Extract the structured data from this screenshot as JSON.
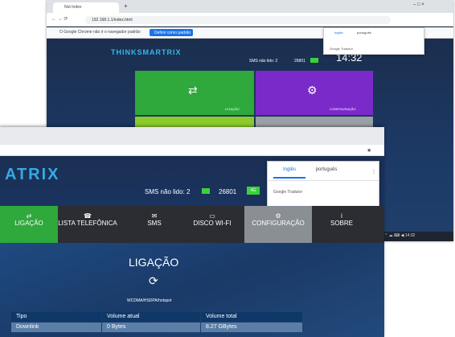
{
  "back_window": {
    "tab_label": "Not Index",
    "new_tab": "+",
    "window_controls": "–  □  ×",
    "url": "192.168.1.1/index.html",
    "nav_icons": "←  →  ⟳",
    "bookmark_text": "O Google Chrome não é o navegador padrão",
    "bookmark_button": "Definir como padrão",
    "logo": "THINKSMARTRIX",
    "sms_text": "SMS não lido: 2",
    "count": "26801",
    "time": "14:32",
    "tile1_label": "LIGAÇÃO",
    "tile2_label": "CONFIGURAÇÃO",
    "popup_tab1": "Inglês",
    "popup_tab2": "português",
    "popup_footer": "Google Tradutor",
    "tray": "⌃ ☁ ⌨ ◀ 14:32"
  },
  "front_window": {
    "logo": "ATRIX",
    "sms_text": "SMS não lido: 2",
    "count": "26801",
    "count_badge": "4G",
    "popup_tab1": "Inglês",
    "popup_tab2": "português",
    "popup_footer": "Google Tradutor",
    "popup_menu": "⋮",
    "star": "★",
    "nav": [
      {
        "icon": "⇄",
        "label": "LIGAÇÃO"
      },
      {
        "icon": "☎",
        "label": "LISTA TELEFÔNICA"
      },
      {
        "icon": "✉",
        "label": "SMS"
      },
      {
        "icon": "▭",
        "label": "DISCO WI-FI"
      },
      {
        "icon": "⚙",
        "label": "CONFIGURAÇÃO"
      },
      {
        "icon": "i",
        "label": "SOBRE"
      }
    ],
    "page_title": "LIGAÇÃO",
    "refresh_icon": "⟳",
    "mode_text": "WCDMA/HSDPA/hotspot",
    "table": {
      "headers": [
        "Tipo",
        "Volume atual",
        "Volume total"
      ],
      "row": [
        "Downlink",
        "0 Bytes",
        "8.27 GBytes"
      ]
    }
  },
  "colors": {
    "tile_green": "#2fa83c",
    "tile_purple": "#7a2ac9",
    "nav_bg": "#2b2d33",
    "nav_active": "#8a8f96",
    "accent_green": "#3bd13b"
  }
}
